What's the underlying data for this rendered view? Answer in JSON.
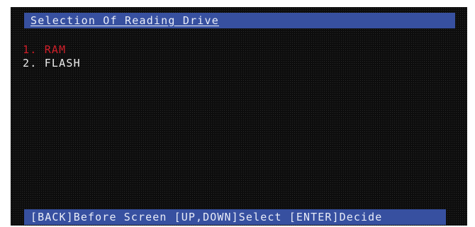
{
  "title": "Selection Of Reading Drive",
  "menu": {
    "items": [
      {
        "number": "1.",
        "label": "RAM",
        "selected": true
      },
      {
        "number": "2.",
        "label": "FLASH",
        "selected": false
      }
    ]
  },
  "status_bar": {
    "hint_back": "[BACK]Before Screen",
    "hint_select": "[UP,DOWN]Select",
    "hint_decide": "[ENTER]Decide"
  },
  "colors": {
    "bar_background": "#3750a0",
    "screen_background": "#0d0d0d",
    "selected_text": "#d0202a",
    "normal_text": "#ececec"
  }
}
